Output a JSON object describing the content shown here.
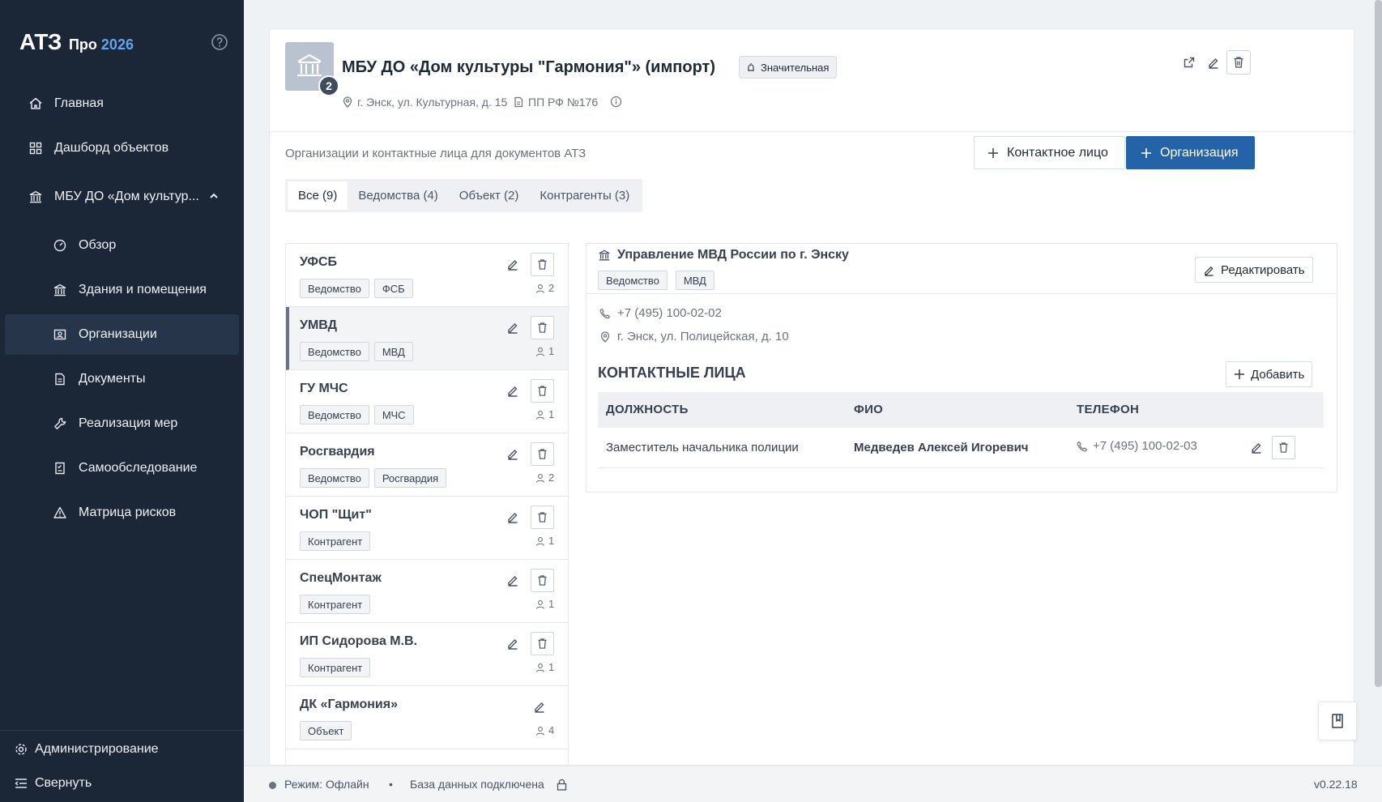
{
  "brand": {
    "logo": "АТЗ",
    "pro": "Про",
    "year": "2026"
  },
  "sidebar": {
    "items": [
      {
        "label": "Главная",
        "icon": "home-icon"
      },
      {
        "label": "Дашборд объектов",
        "icon": "grid-icon"
      },
      {
        "label": "МБУ ДО «Дом культур...",
        "icon": "building-icon"
      },
      {
        "label": "Обзор",
        "icon": "gauge-icon"
      },
      {
        "label": "Здания и помещения",
        "icon": "building-icon"
      },
      {
        "label": "Организации",
        "icon": "org-icon"
      },
      {
        "label": "Документы",
        "icon": "document-icon"
      },
      {
        "label": "Реализация мер",
        "icon": "wrench-icon"
      },
      {
        "label": "Самообследование",
        "icon": "checklist-icon"
      },
      {
        "label": "Матрица рисков",
        "icon": "warning-icon"
      }
    ],
    "admin": "Администрирование",
    "collapse": "Свернуть"
  },
  "object": {
    "title": "МБУ ДО «Дом культуры \"Гармония\"» (импорт)",
    "badge_count": "2",
    "significance": "Значительная",
    "address": "г. Энск, ул. Культурная, д. 15",
    "regulation": "ПП РФ №176"
  },
  "section": {
    "caption": "Организации и контактные лица для документов АТЗ",
    "add_contact": "Контактное лицо",
    "add_org": "Организация"
  },
  "tabs": [
    "Все (9)",
    "Ведомства (4)",
    "Объект (2)",
    "Контрагенты (3)"
  ],
  "orgs": [
    {
      "name": "УФСБ",
      "tags": [
        "Ведомство",
        "ФСБ"
      ],
      "count": "2"
    },
    {
      "name": "УМВД",
      "tags": [
        "Ведомство",
        "МВД"
      ],
      "count": "1"
    },
    {
      "name": "ГУ МЧС",
      "tags": [
        "Ведомство",
        "МЧС"
      ],
      "count": "1"
    },
    {
      "name": "Росгвардия",
      "tags": [
        "Ведомство",
        "Росгвардия"
      ],
      "count": "2"
    },
    {
      "name": "ЧОП \"Щит\"",
      "tags": [
        "Контрагент"
      ],
      "count": "1"
    },
    {
      "name": "СпецМонтаж",
      "tags": [
        "Контрагент"
      ],
      "count": "1"
    },
    {
      "name": "ИП Сидорова М.В.",
      "tags": [
        "Контрагент"
      ],
      "count": "1"
    },
    {
      "name": "ДК «Гармония»",
      "tags": [
        "Объект"
      ],
      "count": "4"
    }
  ],
  "detail": {
    "title": "Управление МВД России по г. Энску",
    "tags": [
      "Ведомство",
      "МВД"
    ],
    "edit": "Редактировать",
    "phone": "+7 (495) 100-02-02",
    "address": "г. Энск, ул. Полицейская, д. 10",
    "contacts_title": "КОНТАКТНЫЕ ЛИЦА",
    "add": "Добавить",
    "columns": [
      "ДОЛЖНОСТЬ",
      "ФИО",
      "ТЕЛЕФОН"
    ],
    "rows": [
      {
        "position": "Заместитель начальника полиции",
        "name": "Медведев Алексей Игоревич",
        "phone": "+7 (495) 100-02-03"
      }
    ]
  },
  "footer": {
    "mode": "Режим: Офлайн",
    "db": "База данных подключена",
    "version": "v0.22.18"
  },
  "colors": {
    "sidebar": "#1b2637",
    "sidebar_active": "#26354a",
    "accent": "#2563a8",
    "brand_year": "#5fa5f0"
  }
}
